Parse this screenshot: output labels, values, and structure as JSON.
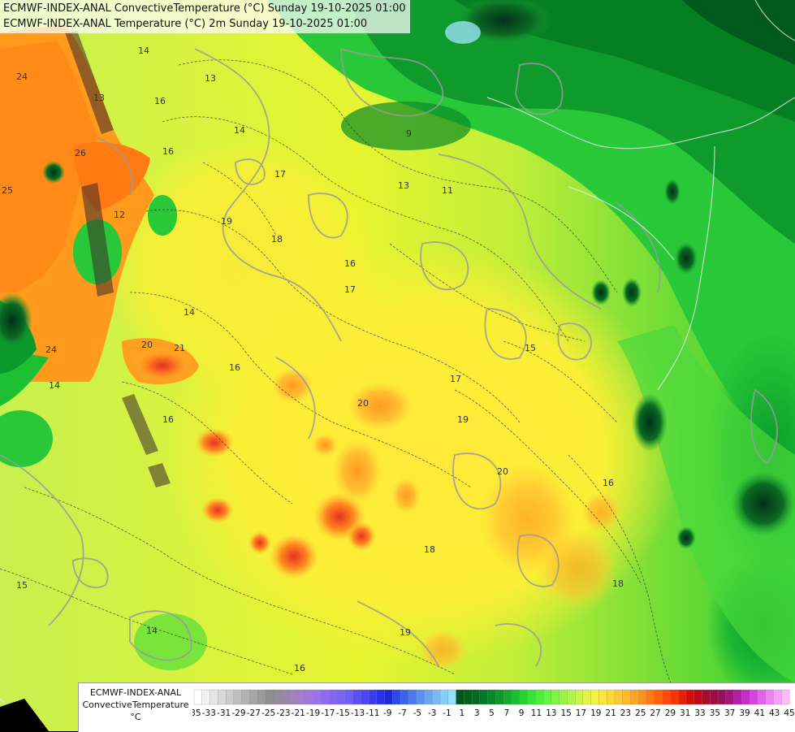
{
  "titles": {
    "line1": "ECMWF-INDEX-ANAL ConvectiveTemperature (°C) Sunday 19-10-2025 01:00",
    "line2": "ECMWF-INDEX-ANAL Temperature (°C) 2m Sunday 19-10-2025 01:00"
  },
  "legend": {
    "model": "ECMWF-INDEX-ANAL",
    "parameter": "ConvectiveTemperature",
    "unit": "°C",
    "labels": [
      "-35",
      "-33",
      "-31",
      "-29",
      "-27",
      "-25",
      "-23",
      "-21",
      "-19",
      "-17",
      "-15",
      "-13",
      "-11",
      "-9",
      "-7",
      "-5",
      "-3",
      "-1",
      "1",
      "3",
      "5",
      "7",
      "9",
      "11",
      "13",
      "15",
      "17",
      "19",
      "21",
      "23",
      "25",
      "27",
      "29",
      "31",
      "33",
      "35",
      "37",
      "39",
      "41",
      "43",
      "45"
    ],
    "colors": [
      "#ffffff",
      "#f2f2f2",
      "#e6e6e6",
      "#d9d9d9",
      "#cccccc",
      "#bfbfbf",
      "#b3b3b3",
      "#a6a6a6",
      "#9a9a9a",
      "#8e8e8e",
      "#938a9a",
      "#9a86a8",
      "#a381bb",
      "#a57ccc",
      "#a078dc",
      "#9a73e8",
      "#8f6af0",
      "#8466f6",
      "#7a62fb",
      "#6f5efd",
      "#5b4ffb",
      "#4a46f6",
      "#3b3cef",
      "#2a31e6",
      "#1f2ad8",
      "#2d49e6",
      "#3a62ec",
      "#4a7af0",
      "#5a90f3",
      "#69a6f6",
      "#78baf8",
      "#86cdfa",
      "#93dffc",
      "#00551a",
      "#005f1c",
      "#006b1f",
      "#007a22",
      "#038a26",
      "#0a9a2a",
      "#12ac2e",
      "#1cbe32",
      "#28d036",
      "#36e33a",
      "#4af03c",
      "#64f53f",
      "#7ff542",
      "#98f544",
      "#b0f545",
      "#c8f546",
      "#dff547",
      "#f2f247",
      "#fae640",
      "#ffd838",
      "#ffc830",
      "#ffb828",
      "#ffa520",
      "#ff9018",
      "#ff7a12",
      "#ff640c",
      "#ff4a08",
      "#f83404",
      "#e81e02",
      "#d60c06",
      "#c20818",
      "#b0092e",
      "#a20c46",
      "#990e5c",
      "#a0167a",
      "#b020a0",
      "#c22fc4",
      "#d445df",
      "#e460ef",
      "#f07ff5",
      "#f89ef8",
      "#fcbafb"
    ],
    "tick_count": 41
  },
  "contour_labels": [
    "24",
    "26",
    "25",
    "24",
    "14",
    "12",
    "13",
    "16",
    "13",
    "16",
    "14",
    "17",
    "19",
    "18",
    "16",
    "17",
    "20",
    "21",
    "16",
    "14",
    "15",
    "19",
    "20",
    "18",
    "18",
    "19",
    "16",
    "14",
    "15",
    "11",
    "13",
    "9",
    "14",
    "20",
    "17",
    "16",
    "16"
  ]
}
